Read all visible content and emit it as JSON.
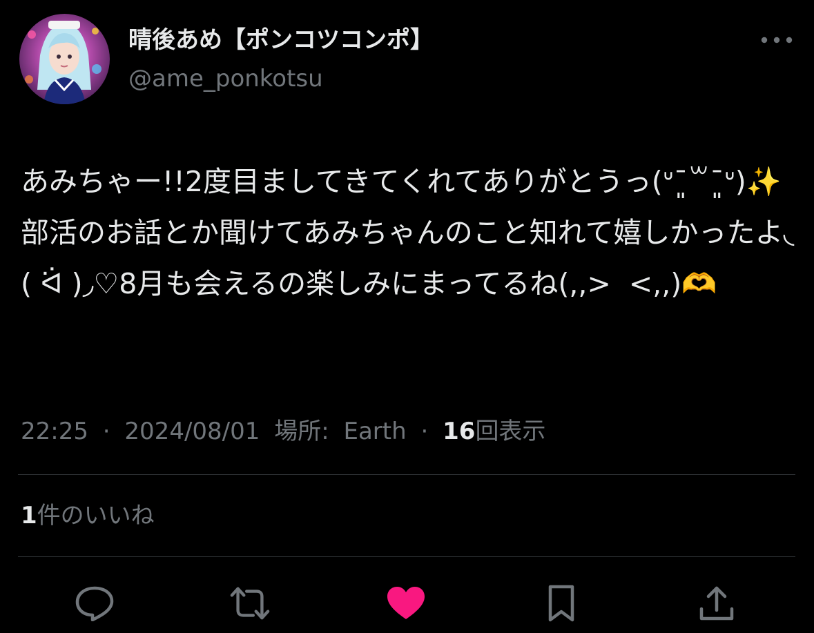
{
  "author": {
    "display_name": "晴後あめ【ポンコツコンポ】",
    "handle": "@ame_ponkotsu"
  },
  "tweet": {
    "text": "あみちゃー!!2度目ましてきてくれてありがとうっ(ᐡ¯͈꒳¯͈ᐡ)✨ 部活のお話とか聞けてあみちゃんのこと知れて嬉しかったよ◟( ᐛ )◞♡8月も会えるの楽しみにまってるね(,,>  <,,)🫶"
  },
  "meta": {
    "time": "22:25",
    "date": "2024/08/01",
    "location_label": "場所:",
    "location": "Earth",
    "views_count": "16",
    "views_label": "回表示",
    "separator": "·"
  },
  "likes": {
    "count": "1",
    "label": "件のいいね"
  },
  "colors": {
    "background": "#000000",
    "text_primary": "#e7e9ea",
    "text_secondary": "#71767b",
    "divider": "#2f3336",
    "like_active": "#f91880"
  },
  "icons": {
    "more": "more-horizontal-icon",
    "reply": "reply-icon",
    "retweet": "retweet-icon",
    "like": "heart-filled-icon",
    "bookmark": "bookmark-icon",
    "share": "share-icon"
  }
}
